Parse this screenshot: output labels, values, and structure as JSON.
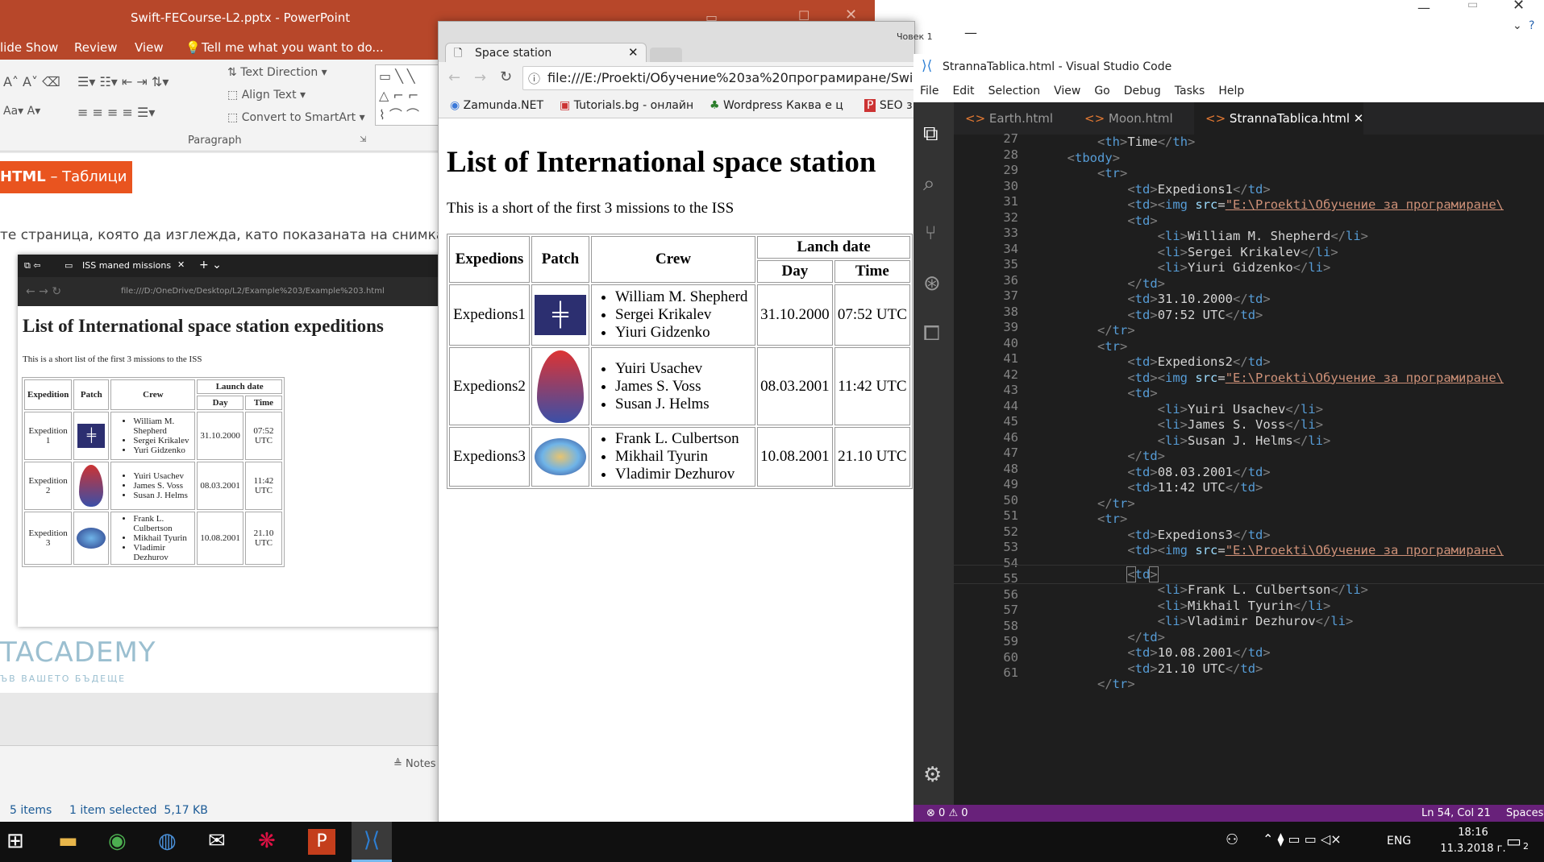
{
  "ppt": {
    "title": "Swift-FECourse-L2.pptx - PowerPoint",
    "tabs": [
      "lide Show",
      "Review",
      "View"
    ],
    "tell_me": "Tell me what you want to do...",
    "text_direction": "Text Direction",
    "align_text": "Align Text",
    "convert_smartart": "Convert to SmartArt",
    "paragraph": "Paragraph",
    "slide_tag_bold": "HTML",
    "slide_tag_rest": " – Таблици",
    "slide_text": "те страница, която да изглежда, като показаната на снимката.",
    "academy": "TACADEMY",
    "academy_sub": "ЪВ ВАШЕТО БЪДЕЩЕ",
    "notes": "Notes",
    "items": "5 items",
    "selected": "1 item selected  5,17 KB"
  },
  "inner_browser": {
    "tab_title": "ISS maned missions",
    "url": "file:///D:/OneDrive/Desktop/L2/Example%203/Example%203.html",
    "heading": "List of International space station expeditions",
    "intro": "This is a short list of the first 3 missions to the ISS",
    "headers": {
      "expedition": "Expedition",
      "patch": "Patch",
      "crew": "Crew",
      "launch": "Launch date",
      "day": "Day",
      "time": "Time"
    },
    "rows": [
      {
        "name": "Expedition 1",
        "crew": [
          "William M. Shepherd",
          "Sergei Krikalev",
          "Yuri Gidzenko"
        ],
        "day": "31.10.2000",
        "time": "07:52 UTC"
      },
      {
        "name": "Expedition 2",
        "crew": [
          "Yuiri Usachev",
          "James S. Voss",
          "Susan J. Helms"
        ],
        "day": "08.03.2001",
        "time": "11:42 UTC"
      },
      {
        "name": "Expedition 3",
        "crew": [
          "Frank L. Culbertson",
          "Mikhail Tyurin",
          "Vladimir Dezhurov"
        ],
        "day": "10.08.2001",
        "time": "21.10 UTC"
      }
    ]
  },
  "browser": {
    "tab_title": "Space station",
    "user": "Човек 1",
    "url": "file:///E:/Proekti/Обучение%20за%20програмиране/Swi",
    "bookmarks": [
      "Zamunda.NET",
      "Tutorials.bg - онлайн",
      "Wordpress Каква е ц",
      "SEO з"
    ],
    "heading": "List of International space station",
    "intro": "This is a short of the first 3 missions to the ISS",
    "headers": {
      "expedition": "Expedions",
      "patch": "Patch",
      "crew": "Crew",
      "launch": "Lanch date",
      "day": "Day",
      "time": "Time"
    },
    "rows": [
      {
        "name": "Expedions1",
        "crew": [
          "William M. Shepherd",
          "Sergei Krikalev",
          "Yiuri Gidzenko"
        ],
        "day": "31.10.2000",
        "time": "07:52 UTC"
      },
      {
        "name": "Expedions2",
        "crew": [
          "Yuiri Usachev",
          "James S. Voss",
          "Susan J. Helms"
        ],
        "day": "08.03.2001",
        "time": "11:42 UTC"
      },
      {
        "name": "Expedions3",
        "crew": [
          "Frank L. Culbertson",
          "Mikhail Tyurin",
          "Vladimir Dezhurov"
        ],
        "day": "10.08.2001",
        "time": "21.10 UTC"
      }
    ]
  },
  "vscode": {
    "title": "StrannaTablica.html - Visual Studio Code",
    "menu": [
      "File",
      "Edit",
      "Selection",
      "View",
      "Go",
      "Debug",
      "Tasks",
      "Help"
    ],
    "tabs": [
      "Earth.html",
      "Moon.html",
      "StrannaTablica.html"
    ],
    "status_errors": "0",
    "status_warnings": "0",
    "status_pos": "Ln 54, Col 21",
    "status_spaces": "Spaces:",
    "img_src": "\"E:\\Proekti\\Обучение за програмиране\\",
    "line_numbers": [
      "27",
      "28",
      "29",
      "30",
      "31",
      "32",
      "33",
      "34",
      "35",
      "36",
      "37",
      "38",
      "39",
      "40",
      "41",
      "42",
      "43",
      "44",
      "45",
      "46",
      "47",
      "48",
      "49",
      "50",
      "51",
      "52",
      "53",
      "54",
      "55",
      "56",
      "57",
      "58",
      "59",
      "60",
      "61"
    ],
    "th_time": "Time",
    "cells": {
      "exp1": "Expedions1",
      "c1": [
        "William M. Shepherd",
        "Sergei Krikalev",
        "Yiuri Gidzenko"
      ],
      "d1": "31.10.2000",
      "t1": "07:52 UTC",
      "exp2": "Expedions2",
      "c2": [
        "Yuiri Usachev",
        "James S. Voss",
        "Susan J. Helms"
      ],
      "d2": "08.03.2001",
      "t2": "11:42 UTC",
      "exp3": "Expedions3",
      "c3": [
        "Frank L. Culbertson",
        "Mikhail Tyurin",
        "Vladimir Dezhurov"
      ],
      "d3": "10.08.2001",
      "t3": "21.10 UTC"
    }
  },
  "taskbar": {
    "lang": "ENG",
    "time": "18:16",
    "date": "11.3.2018 г.",
    "notifications": "2"
  },
  "colors": {
    "ppt_red": "#b7472a",
    "vs_purple": "#68217a",
    "taskbar": "#101010"
  }
}
